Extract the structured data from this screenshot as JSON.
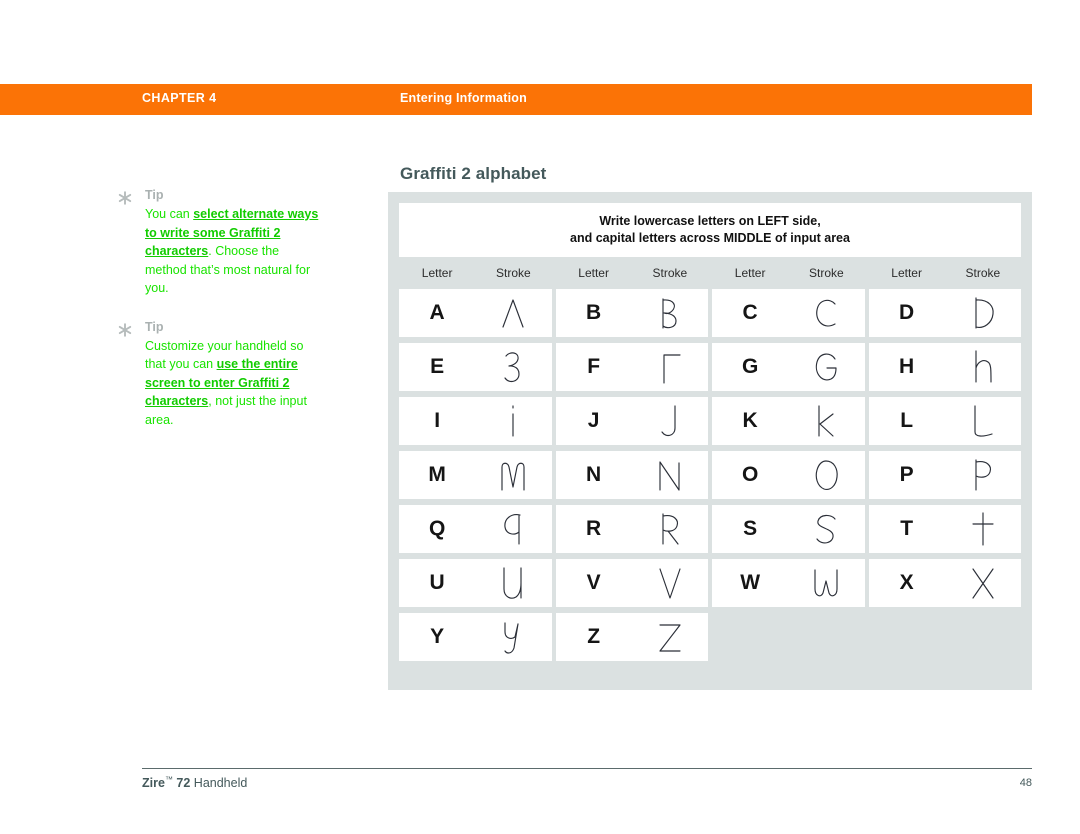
{
  "header": {
    "chapter_label": "CHAPTER 4",
    "section_label": "Entering Information",
    "bar_color": "#fb7306"
  },
  "tips": [
    {
      "icon": "asterisk-icon",
      "title": "Tip",
      "lead": "You can ",
      "emphasis": "select alternate ways to write some Graffiti 2 characters",
      "tail": ". Choose the method that’s most natural for you."
    },
    {
      "icon": "asterisk-icon",
      "title": "Tip",
      "lead": "Customize your handheld so that you can ",
      "emphasis": "use the entire screen to enter Graffiti 2 characters",
      "tail": ", not just the input area."
    }
  ],
  "main": {
    "heading": "Graffiti 2 alphabet",
    "banner_line1": "Write lowercase letters on LEFT side,",
    "banner_line2": "and capital letters across MIDDLE of input area",
    "column_headers": [
      "Letter",
      "Stroke",
      "Letter",
      "Stroke",
      "Letter",
      "Stroke",
      "Letter",
      "Stroke"
    ],
    "letters": [
      [
        "A",
        "B",
        "C",
        "D"
      ],
      [
        "E",
        "F",
        "G",
        "H"
      ],
      [
        "I",
        "J",
        "K",
        "L"
      ],
      [
        "M",
        "N",
        "O",
        "P"
      ],
      [
        "Q",
        "R",
        "S",
        "T"
      ],
      [
        "U",
        "V",
        "W",
        "X"
      ],
      [
        "Y",
        "Z"
      ]
    ],
    "stroke_names": [
      [
        "stroke-a",
        "stroke-b",
        "stroke-c",
        "stroke-d"
      ],
      [
        "stroke-e",
        "stroke-f",
        "stroke-g",
        "stroke-h"
      ],
      [
        "stroke-i",
        "stroke-j",
        "stroke-k",
        "stroke-l"
      ],
      [
        "stroke-m",
        "stroke-n",
        "stroke-o",
        "stroke-p"
      ],
      [
        "stroke-q",
        "stroke-r",
        "stroke-s",
        "stroke-t"
      ],
      [
        "stroke-u",
        "stroke-v",
        "stroke-w",
        "stroke-x"
      ],
      [
        "stroke-y",
        "stroke-z"
      ]
    ],
    "panel_color": "#dbe1e1",
    "heading_color": "#44595b"
  },
  "footer": {
    "product": "Zire",
    "trademark": "™",
    "model": " 72",
    "product_suffix": " Handheld",
    "page_number": "48"
  }
}
